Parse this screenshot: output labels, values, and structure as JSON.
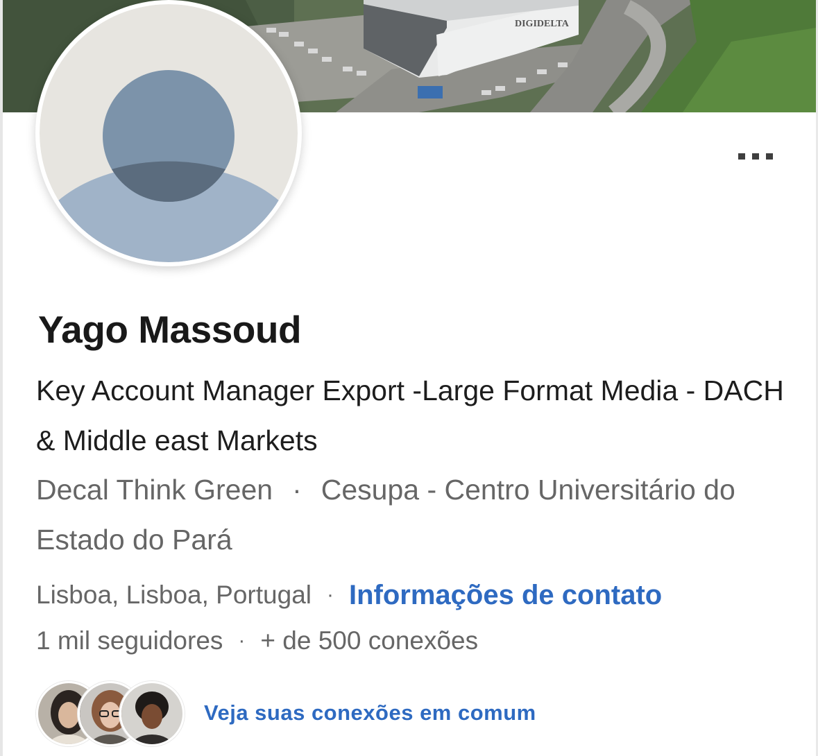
{
  "profile": {
    "name": "Yago Massoud",
    "headline": "Key Account Manager Export -Large Format Media - DACH & Middle east Markets",
    "company": "Decal Think Green",
    "education": "Cesupa - Centro Universitário do Estado do Pará",
    "separator": "·",
    "location": "Lisboa, Lisboa, Portugal",
    "contact_link": "Informações de contato",
    "followers": "1 mil seguidores",
    "connections": "+ de 500 conexões",
    "mutual_link": "Veja suas conexões em comum"
  },
  "cover": {
    "building_sign": "DIGIDELTA"
  },
  "icons": {
    "more": "more-options-icon",
    "avatar": "default-avatar-icon"
  },
  "colors": {
    "link": "#2e6ac1",
    "name": "#191919",
    "secondary_text": "#666666",
    "avatar_bg": "#e7e5e0",
    "avatar_head": "#7c93aa",
    "avatar_body": "#a0b3c8"
  }
}
